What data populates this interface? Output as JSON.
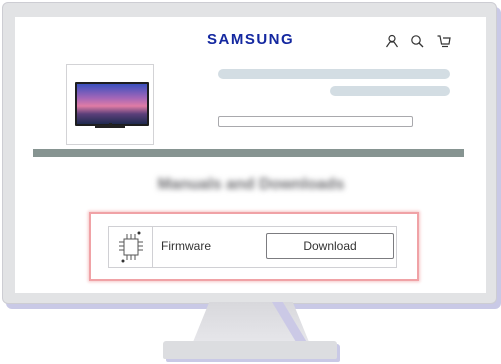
{
  "header": {
    "brand": "SAMSUNG",
    "icons": [
      "account-icon",
      "search-icon",
      "cart-icon"
    ],
    "brand_color": "#1428a0"
  },
  "product": {
    "image": "tv-icon"
  },
  "section": {
    "heading_blurred": "Manuals and Downloads"
  },
  "firmware": {
    "icon": "chip-icon",
    "label": "Firmware",
    "download_label": "Download",
    "highlight_color": "#f0a2a6"
  }
}
